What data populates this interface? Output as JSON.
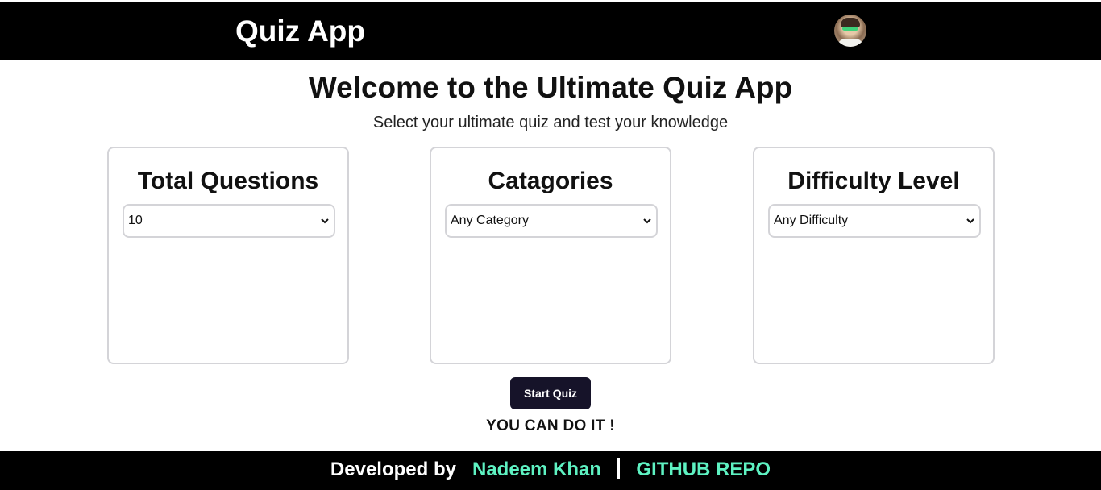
{
  "navbar": {
    "brand": "Quiz App",
    "avatar_icon": "user-avatar"
  },
  "hero": {
    "title": "Welcome to the Ultimate Quiz App",
    "subtitle": "Select your ultimate quiz and test your knowledge"
  },
  "cards": [
    {
      "title": "Total Questions",
      "selected": "10"
    },
    {
      "title": "Catagories",
      "selected": "Any Category"
    },
    {
      "title": "Difficulty Level",
      "selected": "Any Difficulty"
    }
  ],
  "actions": {
    "start_label": "Start Quiz",
    "motto": "YOU CAN DO IT !"
  },
  "footer": {
    "developed_by": "Developed by",
    "author": "Nadeem Khan",
    "repo": "GITHUB REPO"
  },
  "colors": {
    "bar_bg": "#000000",
    "button_bg": "#161329",
    "link": "#5ef2c2",
    "card_border": "#d4d4d8"
  }
}
